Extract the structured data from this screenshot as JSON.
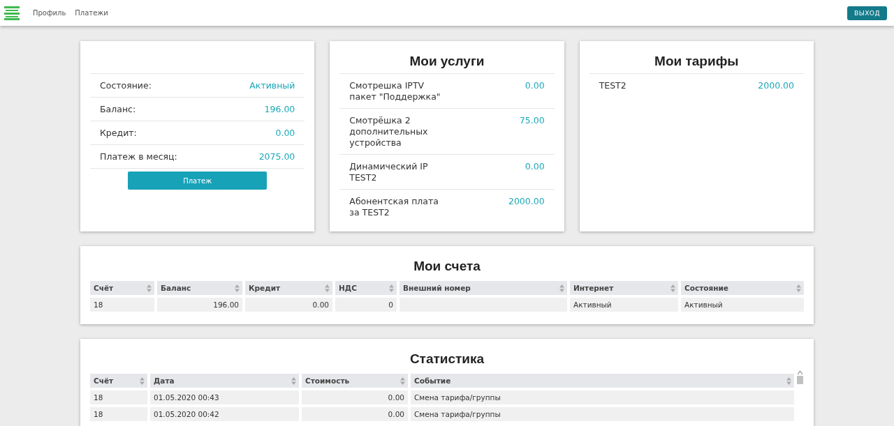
{
  "nav": {
    "links": [
      "Профиль",
      "Платежи"
    ],
    "logout": "ВЫХОД"
  },
  "summary": {
    "rows": [
      {
        "label": "Состояние:",
        "value": "Активный"
      },
      {
        "label": "Баланс:",
        "value": "196.00"
      },
      {
        "label": "Кредит:",
        "value": "0.00"
      },
      {
        "label": "Платеж в месяц:",
        "value": "2075.00"
      }
    ],
    "button": "Платеж"
  },
  "services": {
    "title": "Мои услуги",
    "rows": [
      {
        "label": "Смотрешка IPTV пакет \"Поддержка\"",
        "value": "0.00"
      },
      {
        "label": "Смотрёшка 2 дополнительных устройства",
        "value": "75.00"
      },
      {
        "label": "Динамический IP TEST2",
        "value": "0.00"
      },
      {
        "label": "Абонентская плата за TEST2",
        "value": "2000.00"
      }
    ]
  },
  "tariffs": {
    "title": "Мои тарифы",
    "rows": [
      {
        "label": "TEST2",
        "value": "2000.00"
      }
    ]
  },
  "accounts": {
    "title": "Мои счета",
    "columns": [
      "Счёт",
      "Баланс",
      "Кредит",
      "НДС",
      "Внешний номер",
      "Интернет",
      "Состояние"
    ],
    "rows": [
      [
        "18",
        "196.00",
        "0.00",
        "0",
        "",
        "Активный",
        "Активный"
      ]
    ]
  },
  "statistics": {
    "title": "Статистика",
    "columns": [
      "Счёт",
      "Дата",
      "Стоимость",
      "Событие"
    ],
    "rows": [
      [
        "18",
        "01.05.2020 00:43",
        "0.00",
        "Смена тарифа/группы"
      ],
      [
        "18",
        "01.05.2020 00:42",
        "0.00",
        "Смена тарифа/группы"
      ]
    ]
  }
}
